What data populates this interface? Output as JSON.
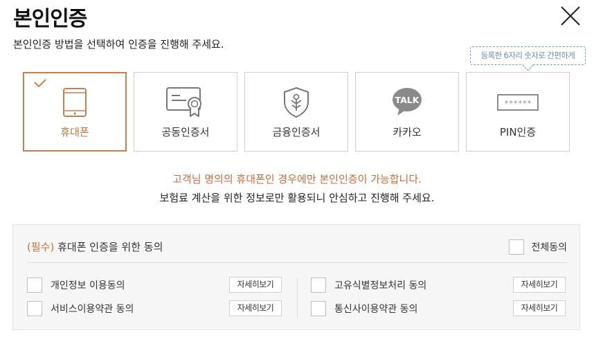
{
  "header": {
    "title": "본인인증",
    "subtitle": "본인인증 방법을 선택하여 인증을 진행해 주세요."
  },
  "tooltip": "등록한 6자리 숫자로 간편하게",
  "methods": [
    {
      "label": "휴대폰",
      "icon": "mobile-phone-icon",
      "selected": true
    },
    {
      "label": "공동인증서",
      "icon": "certificate-icon",
      "selected": false
    },
    {
      "label": "금융인증서",
      "icon": "financial-shield-icon",
      "selected": false
    },
    {
      "label": "카카오",
      "icon": "kakao-talk-icon",
      "icon_text": "TALK",
      "selected": false
    },
    {
      "label": "PIN인증",
      "icon": "pin-input-icon",
      "icon_text": "******",
      "selected": false
    }
  ],
  "notice": {
    "warning": "고객님 명의의 휴대폰인 경우에만 본인인증이 가능합니다.",
    "info": "보험료 계산을 위한 정보로만 활용되니 안심하고 진행해 주세요."
  },
  "consent": {
    "required_tag": "(필수)",
    "title": "휴대폰 인증을 위한 동의",
    "agree_all": "전체동의",
    "items": [
      {
        "label": "개인정보 이용동의",
        "detail": "자세히보기",
        "checked": false
      },
      {
        "label": "서비스이용약관 동의",
        "detail": "자세히보기",
        "checked": false
      },
      {
        "label": "고유식별정보처리 동의",
        "detail": "자세히보기",
        "checked": false
      },
      {
        "label": "통신사이용약관 동의",
        "detail": "자세히보기",
        "checked": false
      }
    ]
  },
  "colors": {
    "accent": "#c87f48",
    "warning_text": "#c86b3a",
    "tooltip_border": "#6a9fbd"
  }
}
